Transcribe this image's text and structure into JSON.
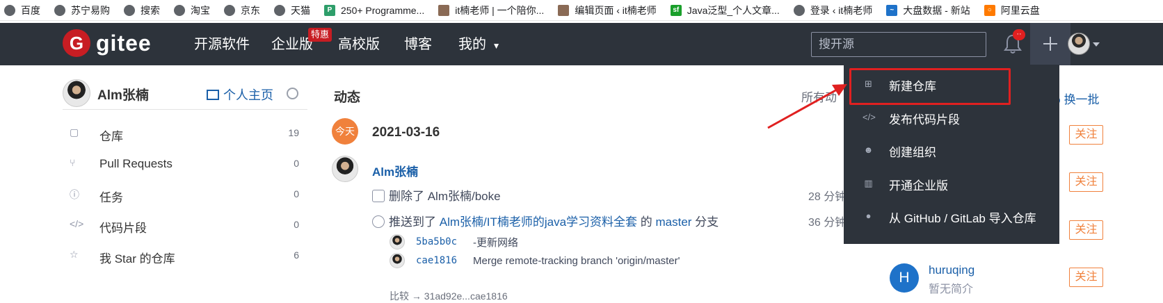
{
  "bookmarks": [
    {
      "label": "百度",
      "icon": "globe-icon"
    },
    {
      "label": "苏宁易购",
      "icon": "globe-icon"
    },
    {
      "label": "搜索",
      "icon": "globe-icon"
    },
    {
      "label": "淘宝",
      "icon": "globe-icon"
    },
    {
      "label": "京东",
      "icon": "globe-icon"
    },
    {
      "label": "天猫",
      "icon": "globe-icon"
    },
    {
      "label": "250+ Programme...",
      "icon": "p-icon"
    },
    {
      "label": "it楠老师 | 一个陪你...",
      "icon": "avatar-icon"
    },
    {
      "label": "编辑页面 ‹ it楠老师",
      "icon": "avatar-icon"
    },
    {
      "label": "Java泛型_个人文章...",
      "icon": "sf-icon"
    },
    {
      "label": "登录 ‹ it楠老师",
      "icon": "globe-icon"
    },
    {
      "label": "大盘数据 - 新站",
      "icon": "chart-icon"
    },
    {
      "label": "阿里云盘",
      "icon": "cloud-icon"
    }
  ],
  "header": {
    "logo_letter": "G",
    "logo_text": "gitee",
    "nav": [
      "开源软件",
      "企业版",
      "高校版",
      "博客",
      "我的"
    ],
    "nav_badge": "特惠",
    "search_placeholder": "搜开源",
    "bell_badge": "··"
  },
  "sidebar": {
    "user_name": "Alm张楠",
    "home_label": "个人主页",
    "items": [
      {
        "label": "仓库",
        "count": "19",
        "icon": "repo-icon"
      },
      {
        "label": "Pull Requests",
        "count": "0",
        "icon": "pull-request-icon"
      },
      {
        "label": "任务",
        "count": "0",
        "icon": "issue-icon"
      },
      {
        "label": "代码片段",
        "count": "0",
        "icon": "code-icon"
      },
      {
        "label": "我 Star 的仓库",
        "count": "6",
        "icon": "star-icon"
      }
    ]
  },
  "feed": {
    "title": "动态",
    "filter_label": "所有动",
    "today_label": "今天",
    "date": "2021-03-16",
    "user": "Alm张楠",
    "activities": [
      {
        "prefix": "删除了 Alm张楠/boke",
        "time": "28 分钟"
      },
      {
        "prefix": "推送到了 ",
        "repo": "Alm张楠/IT楠老师的java学习资料全套",
        "mid": " 的 ",
        "branch": "master",
        "suffix": " 分支",
        "time": "36 分钟"
      }
    ],
    "commits": [
      {
        "sha": "5ba5b0c",
        "message": "-更新网络"
      },
      {
        "sha": "cae1816",
        "message": "Merge remote-tracking branch 'origin/master'"
      }
    ],
    "compare": "比较 → 31ad92e...cae1816"
  },
  "recommend": {
    "refresh_label": "换一批",
    "follow_label": "关注",
    "cut_bio": "暂无简介",
    "user_initial": "H",
    "user_name": "huruqing",
    "user_bio": "暂无简介"
  },
  "dropdown": {
    "items": [
      {
        "label": "新建仓库",
        "icon": "plus-square-icon"
      },
      {
        "label": "发布代码片段",
        "icon": "code-icon"
      },
      {
        "label": "创建组织",
        "icon": "group-icon"
      },
      {
        "label": "开通企业版",
        "icon": "building-icon"
      },
      {
        "label": "从 GitHub / GitLab 导入仓库",
        "icon": "github-icon"
      }
    ]
  },
  "colors": {
    "header_bg": "#2d333b",
    "brand_red": "#c71d23",
    "link_blue": "#1a5fa8",
    "follow_orange": "#f0813c",
    "annotation_red": "#e02020"
  }
}
